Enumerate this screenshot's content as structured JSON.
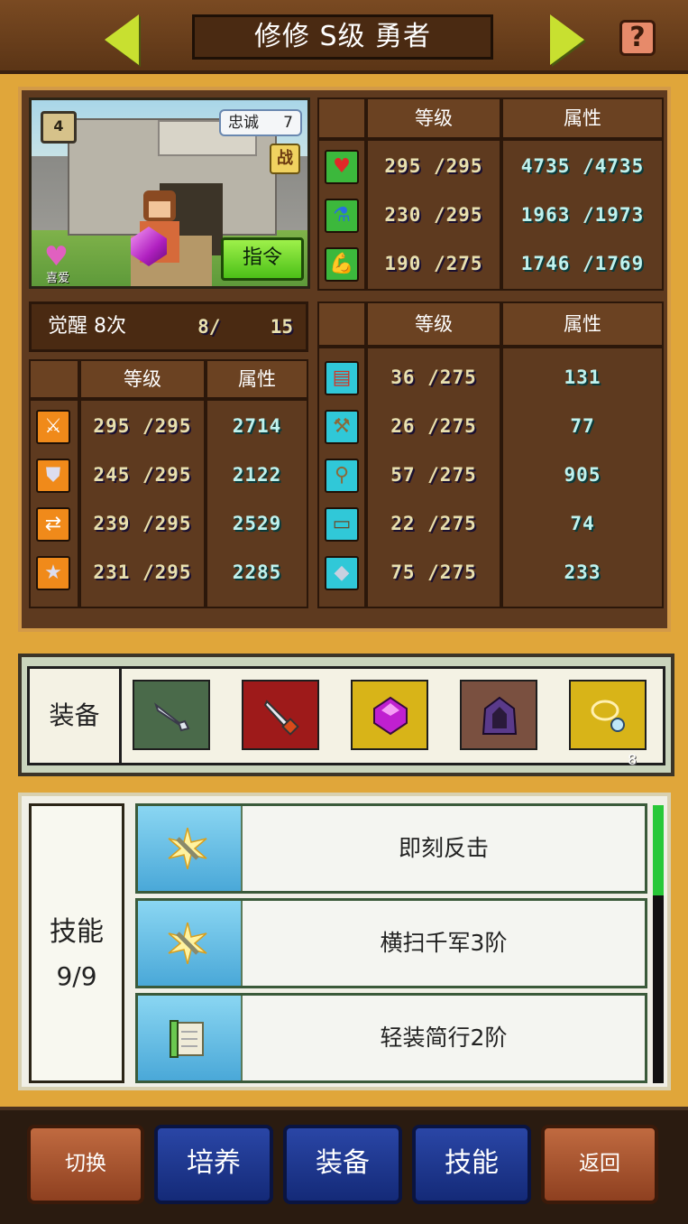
{
  "header": {
    "title": "修修 S级 勇者",
    "help_label": "?"
  },
  "portrait": {
    "bag_label": "4",
    "loyalty_label": "忠诚",
    "loyalty_value": "7",
    "battle_label": "战",
    "love_label": "喜爱",
    "command_label": "指令"
  },
  "top_stats": {
    "headers": [
      "等级",
      "属性"
    ],
    "rows": [
      {
        "icon": "heart-icon",
        "level": "295 /295",
        "attr": "4735 /4735"
      },
      {
        "icon": "potion-icon",
        "level": "230 /295",
        "attr": "1963 /1973"
      },
      {
        "icon": "strength-icon",
        "level": "190 /275",
        "attr": "1746 /1769"
      }
    ]
  },
  "awaken": {
    "label": "觉醒 8次",
    "current": "8/",
    "max": "15"
  },
  "combat_stats": {
    "headers": [
      "等级",
      "属性"
    ],
    "rows": [
      {
        "icon": "sword-icon",
        "level": "295 /295",
        "attr": "2714"
      },
      {
        "icon": "shield-icon",
        "level": "245 /295",
        "attr": "2122"
      },
      {
        "icon": "agility-icon",
        "level": "239 /295",
        "attr": "2529"
      },
      {
        "icon": "star-icon",
        "level": "231 /295",
        "attr": "2285"
      }
    ]
  },
  "craft_stats": {
    "headers": [
      "等级",
      "属性"
    ],
    "rows": [
      {
        "icon": "book-icon",
        "level": "36 /275",
        "attr": "131"
      },
      {
        "icon": "pickaxe-icon",
        "level": "26 /275",
        "attr": "77"
      },
      {
        "icon": "shovel-icon",
        "level": "57 /275",
        "attr": "905"
      },
      {
        "icon": "anvil-icon",
        "level": "22 /275",
        "attr": "74"
      },
      {
        "icon": "gauntlet-icon",
        "level": "75 /275",
        "attr": "233"
      }
    ]
  },
  "equipment": {
    "label": "装备",
    "slots": [
      {
        "icon": "dagger-icon",
        "bg": "#4a6a4a"
      },
      {
        "icon": "sword-red-icon",
        "bg": "#9e1a1a"
      },
      {
        "icon": "purple-gem-icon",
        "bg": "#d8b418"
      },
      {
        "icon": "cloak-icon",
        "bg": "#7a5040"
      },
      {
        "icon": "necklace-icon",
        "bg": "#d8b418"
      }
    ],
    "badge": "8"
  },
  "skills": {
    "label": "技能",
    "count": "9/9",
    "items": [
      {
        "name": "即刻反击",
        "icon": "burst-sword-icon"
      },
      {
        "name": "横扫千军3阶",
        "icon": "burst-sword-icon"
      },
      {
        "name": "轻装简行2阶",
        "icon": "scroll-icon"
      }
    ]
  },
  "bottom_nav": {
    "switch": "切换",
    "train": "培养",
    "equip": "装备",
    "skill": "技能",
    "back": "返回"
  }
}
